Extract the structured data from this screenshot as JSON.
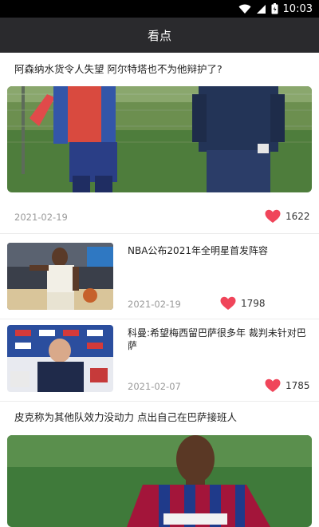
{
  "status_bar": {
    "time": "10:03"
  },
  "app_bar": {
    "title": "看点"
  },
  "feed": {
    "items": [
      {
        "title": "阿森纳水货令人失望 阿尔特塔也不为他辩护了?",
        "date": "2021-02-19",
        "likes": "1622",
        "image_icon": "football-training-photo"
      },
      {
        "title": "NBA公布2021年全明星首发阵容",
        "date": "2021-02-19",
        "likes": "1798",
        "image_icon": "basketball-player-photo"
      },
      {
        "title": "科曼:希望梅西留巴萨很多年 裁判未针对巴萨",
        "date": "2021-02-07",
        "likes": "1785",
        "image_icon": "press-conference-photo"
      },
      {
        "title": "皮克称为其他队效力没动力 点出自己在巴萨接班人",
        "image_icon": "barcelona-player-photo"
      }
    ]
  },
  "colors": {
    "app_bar": "#2a2a2d",
    "heart": "#f0455a",
    "date": "#9a9a9a"
  }
}
